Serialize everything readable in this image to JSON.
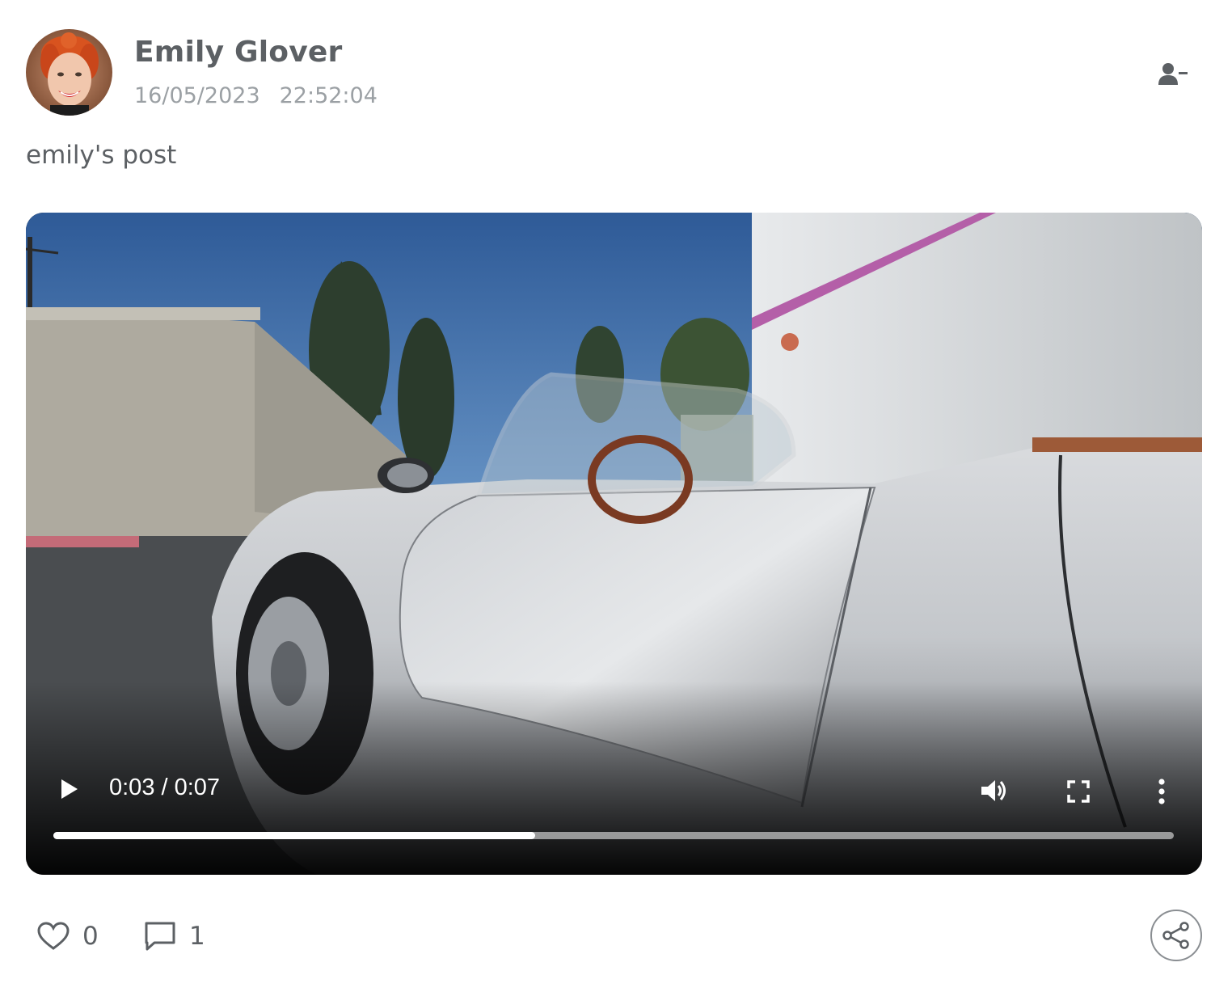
{
  "author": {
    "name": "Emily Glover",
    "date": "16/05/2023",
    "time": "22:52:04"
  },
  "post": {
    "text": "emily's post"
  },
  "video": {
    "time_readout": "0:03 / 0:07",
    "progress_fraction": 0.43
  },
  "footer": {
    "like_count": "0",
    "comment_count": "1"
  },
  "icons": {
    "unfollow": "user-minus-icon",
    "play": "play-icon",
    "volume": "volume-icon",
    "fullscreen": "fullscreen-icon",
    "menu": "more-vertical-icon",
    "like": "heart-icon",
    "comment": "comment-icon",
    "share": "share-icon"
  },
  "colors": {
    "text": "#5c6064",
    "muted": "#9ba0a4",
    "video_bg": "#000000"
  }
}
